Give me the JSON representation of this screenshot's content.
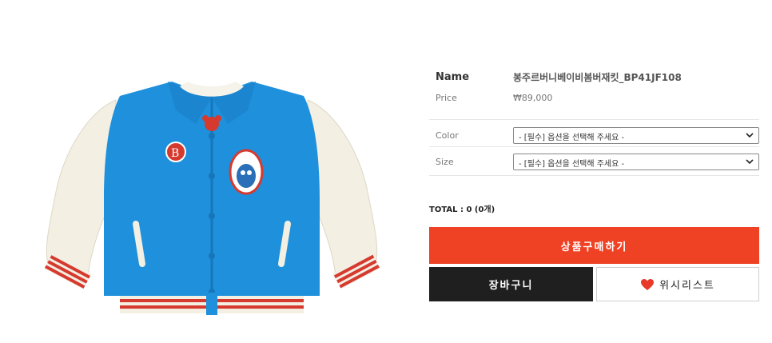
{
  "product": {
    "image_icon": "jacket-product-image",
    "name_label": "Name",
    "name_value": "봉주르버니베이비봄버재킷_BP41JF108",
    "price_label": "Price",
    "price_value": "₩89,000"
  },
  "options": {
    "color_label": "Color",
    "color_value": "- [필수] 옵션을 선택해 주세요 -",
    "size_label": "Size",
    "size_value": "- [필수] 옵션을 선택해 주세요 -"
  },
  "total": "TOTAL : 0 (0개)",
  "buttons": {
    "buy": "상품구매하기",
    "cart": "장바구니",
    "wishlist": "위시리스트"
  },
  "colors": {
    "buy_button": "#ef4123",
    "cart_button": "#1f1f1f",
    "heart": "#e8392b",
    "jacket_blue": "#1e90dc",
    "jacket_cream": "#f3efe3",
    "rib_red": "#d63a2f"
  }
}
